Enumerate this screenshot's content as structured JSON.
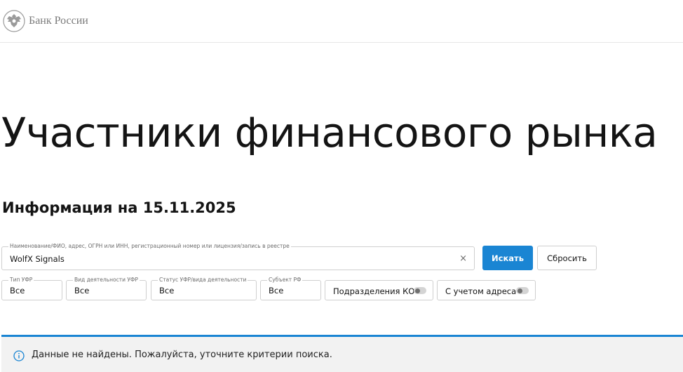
{
  "header": {
    "brand": "Банк России",
    "logo_icon": "eagle-emblem-icon"
  },
  "page": {
    "title": "Участники финансового рынка",
    "subtitle": "Информация на 15.11.2025"
  },
  "search": {
    "label": "Наименование/ФИО, адрес, ОГРН или ИНН, регистрационный номер или лицензия/запись в реестре",
    "value": "WolfX Signals",
    "clear_icon": "×",
    "search_button": "Искать",
    "reset_button": "Сбросить"
  },
  "filters": [
    {
      "label": "Тип УФР",
      "value": "Все"
    },
    {
      "label": "Вид деятельности УФР",
      "value": "Все"
    },
    {
      "label": "Статус УФР/вида деятельности",
      "value": "Все"
    },
    {
      "label": "Субъект РФ",
      "value": "Все"
    }
  ],
  "toggles": [
    {
      "label": "Подразделения КО",
      "enabled": false
    },
    {
      "label": "С учетом адреса",
      "enabled": false
    }
  ],
  "notice": {
    "icon": "info-icon",
    "text": "Данные не найдены. Пожалуйста, уточните критерии поиска.",
    "accent_color": "#1a85d3"
  },
  "colors": {
    "primary": "#1a85d3",
    "notice_bg": "#f2f2f2"
  }
}
